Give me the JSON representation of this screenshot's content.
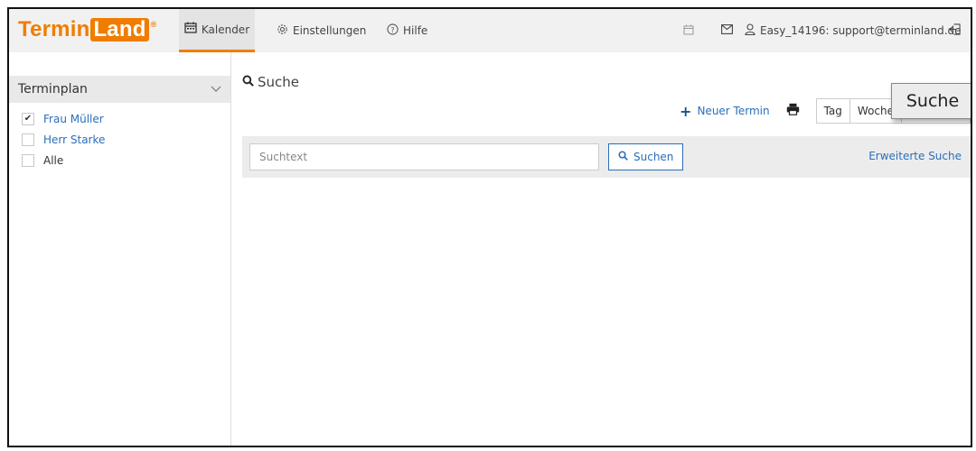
{
  "logo": {
    "part1": "Termin",
    "part2": "Land",
    "reg": "®"
  },
  "nav": {
    "calendar": {
      "icon": "calendar-icon",
      "label": "Kalender"
    },
    "settings": {
      "icon": "gear-icon",
      "label": "Einstellungen"
    },
    "help": {
      "icon": "help-icon",
      "label": "Hilfe"
    }
  },
  "user": {
    "account": "Easy_14196: support@terminland.de"
  },
  "sidebar": {
    "title": "Terminplan",
    "items": [
      {
        "label": "Frau Müller",
        "checked": true
      },
      {
        "label": "Herr Starke",
        "checked": false
      },
      {
        "label": "Alle",
        "checked": false
      }
    ]
  },
  "main": {
    "title": "Suche",
    "new_appointment": "Neuer Termin",
    "view_buttons": [
      "Tag",
      "Woche"
    ],
    "tooltip": "Suche",
    "search": {
      "placeholder": "Suchtext",
      "button": "Suchen",
      "advanced": "Erweiterte Suche"
    }
  },
  "colors": {
    "brand": "#f07d00",
    "link": "#2a6ebb"
  }
}
